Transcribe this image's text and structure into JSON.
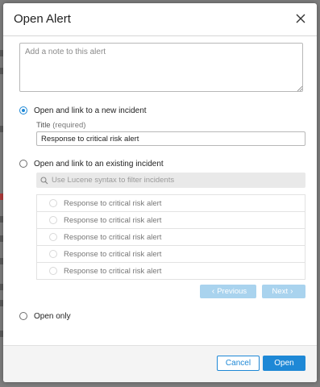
{
  "dialog": {
    "title": "Open Alert",
    "close_icon": "close-icon"
  },
  "note": {
    "placeholder": "Add a note to this alert",
    "value": ""
  },
  "options": {
    "new_incident": {
      "label": "Open and link to a new incident",
      "checked": true,
      "title_label": "Title",
      "title_required": "(required)",
      "title_value": "Response to critical risk alert"
    },
    "existing_incident": {
      "label": "Open and link to an existing incident",
      "checked": false,
      "search_icon": "search-icon",
      "search_placeholder": "Use Lucene syntax to filter incidents",
      "incidents": [
        {
          "label": "Response to critical risk alert"
        },
        {
          "label": "Response to critical risk alert"
        },
        {
          "label": "Response to critical risk alert"
        },
        {
          "label": "Response to critical risk alert"
        },
        {
          "label": "Response to critical risk alert"
        }
      ],
      "previous_label": "Previous",
      "next_label": "Next"
    },
    "open_only": {
      "label": "Open only",
      "checked": false
    }
  },
  "footer": {
    "cancel_label": "Cancel",
    "open_label": "Open"
  },
  "colors": {
    "accent": "#1e88d6",
    "disabled_button": "#a9d3ee"
  }
}
